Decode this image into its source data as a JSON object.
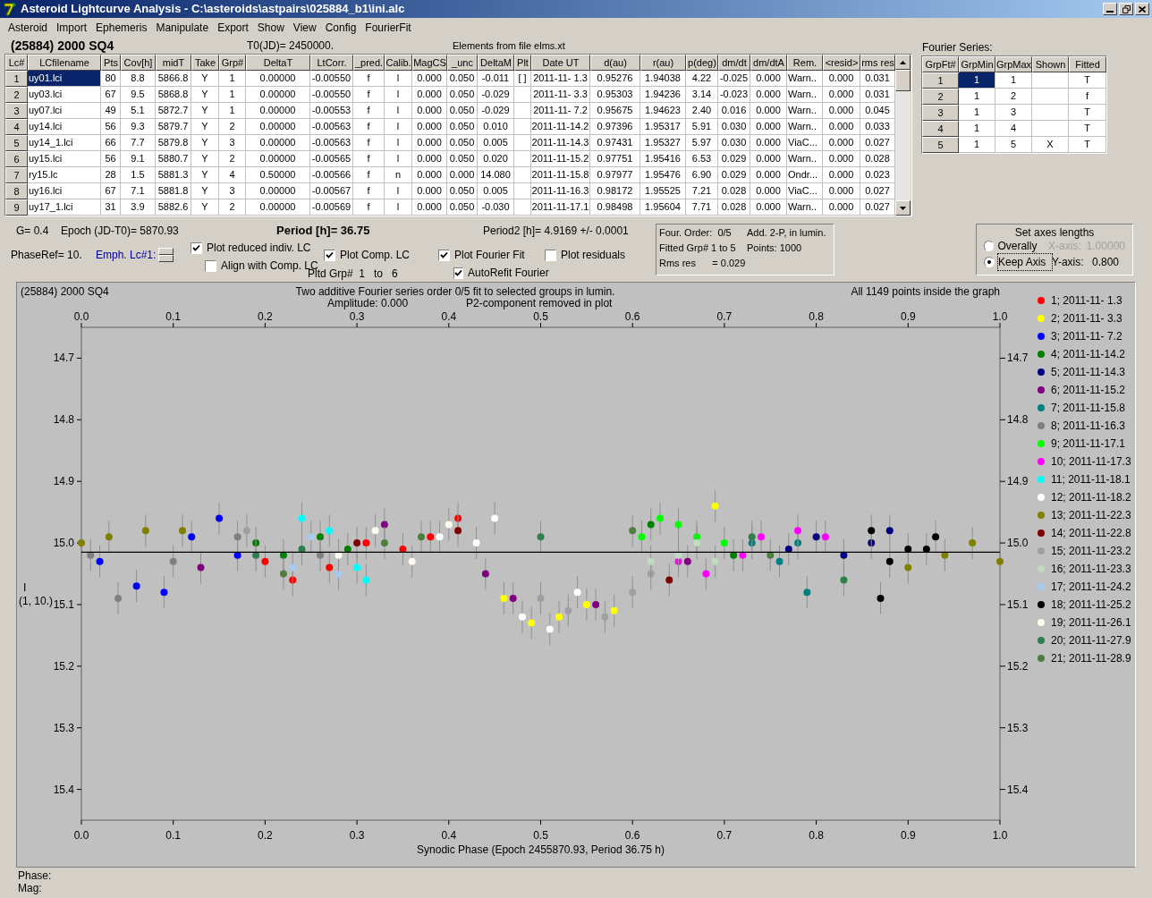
{
  "window": {
    "title": "Asteroid Lightcurve Analysis - C:\\asteroids\\astpairs\\025884_b1\\ini.alc"
  },
  "menu": [
    "Asteroid",
    "Import",
    "Ephemeris",
    "Manipulate",
    "Export",
    "Show",
    "View",
    "Config",
    "FourierFit"
  ],
  "header": {
    "asteroid": "(25884) 2000 SQ4",
    "t0": "T0(JD)= 2450000.",
    "elements": "Elements from file elms.xt"
  },
  "lc_table": {
    "columns": [
      "Lc#",
      "LCfilename",
      "Pts",
      "Cov[h]",
      "midT",
      "Take",
      "Grp#",
      "DeltaT",
      "LtCorr.",
      "_pred.",
      "Calib.",
      "MagCS",
      "_unc",
      "DeltaM",
      "Plt",
      "Date UT",
      "d(au)",
      "r(au)",
      "p(deg)",
      "dm/dt",
      "dm/dtA",
      "Rem.",
      "<resid>",
      "rms res"
    ],
    "rows": [
      {
        "selected": true,
        "cells": [
          "1",
          "uy01.lci",
          "80",
          "8.8",
          "5866.8",
          "Y",
          "1",
          "0.00000",
          "-0.00550",
          "f",
          "l",
          "0.000",
          "0.050",
          "-0.011",
          "[ ]",
          "2011-11- 1.3",
          "0.95276",
          "1.94038",
          "4.22",
          "-0.025",
          "0.000",
          "Warn..",
          "0.000",
          "0.031"
        ]
      },
      {
        "selected": false,
        "cells": [
          "2",
          "uy03.lci",
          "67",
          "9.5",
          "5868.8",
          "Y",
          "1",
          "0.00000",
          "-0.00550",
          "f",
          "l",
          "0.000",
          "0.050",
          "-0.029",
          "",
          "2011-11- 3.3",
          "0.95303",
          "1.94236",
          "3.14",
          "-0.023",
          "0.000",
          "Warn..",
          "0.000",
          "0.031"
        ]
      },
      {
        "selected": false,
        "cells": [
          "3",
          "uy07.lci",
          "49",
          "5.1",
          "5872.7",
          "Y",
          "1",
          "0.00000",
          "-0.00553",
          "f",
          "l",
          "0.000",
          "0.050",
          "-0.029",
          "",
          "2011-11- 7.2",
          "0.95675",
          "1.94623",
          "2.40",
          "0.016",
          "0.000",
          "Warn..",
          "0.000",
          "0.045"
        ]
      },
      {
        "selected": false,
        "cells": [
          "4",
          "uy14.lci",
          "56",
          "9.3",
          "5879.7",
          "Y",
          "2",
          "0.00000",
          "-0.00563",
          "f",
          "l",
          "0.000",
          "0.050",
          "0.010",
          "",
          "2011-11-14.2",
          "0.97396",
          "1.95317",
          "5.91",
          "0.030",
          "0.000",
          "Warn..",
          "0.000",
          "0.033"
        ]
      },
      {
        "selected": false,
        "cells": [
          "5",
          "uy14_1.lci",
          "66",
          "7.7",
          "5879.8",
          "Y",
          "3",
          "0.00000",
          "-0.00563",
          "f",
          "l",
          "0.000",
          "0.050",
          "0.005",
          "",
          "2011-11-14.3",
          "0.97431",
          "1.95327",
          "5.97",
          "0.030",
          "0.000",
          "ViaC...",
          "0.000",
          "0.027"
        ]
      },
      {
        "selected": false,
        "cells": [
          "6",
          "uy15.lci",
          "56",
          "9.1",
          "5880.7",
          "Y",
          "2",
          "0.00000",
          "-0.00565",
          "f",
          "l",
          "0.000",
          "0.050",
          "0.020",
          "",
          "2011-11-15.2",
          "0.97751",
          "1.95416",
          "6.53",
          "0.029",
          "0.000",
          "Warn..",
          "0.000",
          "0.028"
        ]
      },
      {
        "selected": false,
        "cells": [
          "7",
          "ry15.lc",
          "28",
          "1.5",
          "5881.3",
          "Y",
          "4",
          "0.50000",
          "-0.00566",
          "f",
          "n",
          "0.000",
          "0.000",
          "14.080",
          "",
          "2011-11-15.8",
          "0.97977",
          "1.95476",
          "6.90",
          "0.029",
          "0.000",
          "Ondr...",
          "0.000",
          "0.023"
        ]
      },
      {
        "selected": false,
        "cells": [
          "8",
          "uy16.lci",
          "67",
          "7.1",
          "5881.8",
          "Y",
          "3",
          "0.00000",
          "-0.00567",
          "f",
          "l",
          "0.000",
          "0.050",
          "0.005",
          "",
          "2011-11-16.3",
          "0.98172",
          "1.95525",
          "7.21",
          "0.028",
          "0.000",
          "ViaC...",
          "0.000",
          "0.027"
        ]
      },
      {
        "selected": false,
        "cells": [
          "9",
          "uy17_1.lci",
          "31",
          "3.9",
          "5882.6",
          "Y",
          "2",
          "0.00000",
          "-0.00569",
          "f",
          "l",
          "0.000",
          "0.050",
          "-0.030",
          "",
          "2011-11-17.1",
          "0.98498",
          "1.95604",
          "7.71",
          "0.028",
          "0.000",
          "Warn..",
          "0.000",
          "0.027"
        ]
      }
    ]
  },
  "fourier": {
    "title": "Fourier Series:",
    "columns": [
      "GrpFt#",
      "GrpMin",
      "GrpMax",
      "Shown",
      "Fitted"
    ],
    "rows": [
      {
        "selected": true,
        "cells": [
          "1",
          "1",
          "1",
          "",
          "T"
        ]
      },
      {
        "selected": false,
        "cells": [
          "2",
          "1",
          "2",
          "",
          "f"
        ]
      },
      {
        "selected": false,
        "cells": [
          "3",
          "1",
          "3",
          "",
          "T"
        ]
      },
      {
        "selected": false,
        "cells": [
          "4",
          "1",
          "4",
          "",
          "T"
        ]
      },
      {
        "selected": false,
        "cells": [
          "5",
          "1",
          "5",
          "X",
          "T"
        ]
      }
    ]
  },
  "info": {
    "g": "G= 0.4",
    "epoch": "Epoch (JD-T0)= 5870.93",
    "period": "Period [h]= 36.75",
    "period2": "Period2 [h]= 4.9169 +/- 0.0001",
    "phase_ref": "PhaseRef= 10.",
    "emph": "Emph. Lc#1:",
    "pltd_grp": "Pltd Grp#  1   to   6"
  },
  "options": [
    {
      "label": "Plot reduced indiv. LC",
      "checked": true
    },
    {
      "label": "Align with Comp. LC",
      "checked": false
    },
    {
      "label": "Plot Comp. LC",
      "checked": true
    },
    {
      "label": "Plot Fourier Fit",
      "checked": true
    },
    {
      "label": "AutoRefit Fourier",
      "checked": true
    },
    {
      "label": "Plot residuals",
      "checked": false
    }
  ],
  "fit_summary": [
    "Four. Order:  0/5",
    "Add. 2-P, in lumin.",
    "Fitted Grp# 1 to 5",
    "Points: 1000",
    "Rms res      = 0.029"
  ],
  "axes": {
    "title": "Set axes lengths",
    "modes": [
      {
        "label": "Overally",
        "selected": false
      },
      {
        "label": "Keep Axis",
        "selected": true
      }
    ],
    "x_label": "X-axis:",
    "x_value": "1.00000",
    "x_disabled": true,
    "y_label": "Y-axis:",
    "y_value": "0.800"
  },
  "plot": {
    "object": "(25884) 2000 SQ4",
    "caption": "Two additive Fourier series order 0/5 fit to selected groups in lumin.",
    "amplitude": "Amplitude: 0.000",
    "p2_note": "P2-component removed in plot",
    "inside_note": "All 1149 points inside the graph",
    "ylabel_note": "(1, 10.)",
    "chart_data": {
      "type": "scatter",
      "xlabel": "Synodic Phase (Epoch 2455870.93, Period 36.75 h)",
      "ylabel": "I",
      "xlim": [
        0,
        1
      ],
      "ylim": [
        15.45,
        14.65
      ],
      "xticks": [
        {
          "value": 0,
          "label": "0.0"
        },
        {
          "value": 0.1,
          "label": "0.1"
        },
        {
          "value": 0.2,
          "label": "0.2"
        },
        {
          "value": 0.3,
          "label": "0.3"
        },
        {
          "value": 0.4,
          "label": "0.4"
        },
        {
          "value": 0.5,
          "label": "0.5"
        },
        {
          "value": 0.6,
          "label": "0.6"
        },
        {
          "value": 0.7,
          "label": "0.7"
        },
        {
          "value": 0.8,
          "label": "0.8"
        },
        {
          "value": 0.9,
          "label": "0.9"
        },
        {
          "value": 1,
          "label": "1.0"
        }
      ],
      "yticks": [
        {
          "value": 14.7,
          "label": "14.7"
        },
        {
          "value": 14.8,
          "label": "14.8"
        },
        {
          "value": 14.9,
          "label": "14.9"
        },
        {
          "value": 15.0,
          "label": "15.0"
        },
        {
          "value": 15.1,
          "label": "15.1"
        },
        {
          "value": 15.2,
          "label": "15.2"
        },
        {
          "value": 15.3,
          "label": "15.3"
        },
        {
          "value": 15.4,
          "label": "15.4"
        }
      ],
      "ref_lines": [
        {
          "axis": "y",
          "value": 15.015
        }
      ],
      "legend": "right",
      "series": [
        {
          "name": "1; 2011-11- 1.3",
          "color": "#ff0000",
          "x": [
            0.2,
            0.23,
            0.27,
            0.31,
            0.35,
            0.38,
            0.41
          ],
          "values": [
            15.03,
            15.06,
            15.04,
            15.0,
            15.01,
            14.99,
            14.96
          ]
        },
        {
          "name": "2; 2011-11- 3.3",
          "color": "#ffff00",
          "x": [
            0.46,
            0.49,
            0.52,
            0.55,
            0.58,
            0.69
          ],
          "values": [
            15.09,
            15.13,
            15.12,
            15.1,
            15.11,
            14.94
          ]
        },
        {
          "name": "3; 2011-11- 7.2",
          "color": "#0000ff",
          "x": [
            0.02,
            0.06,
            0.09,
            0.12,
            0.15,
            0.17
          ],
          "values": [
            15.03,
            15.07,
            15.08,
            14.99,
            14.96,
            15.02
          ]
        },
        {
          "name": "4; 2011-11-14.2",
          "color": "#008000",
          "x": [
            0.19,
            0.22,
            0.26,
            0.29,
            0.62,
            0.71
          ],
          "values": [
            15.0,
            15.02,
            14.99,
            15.01,
            14.97,
            15.02
          ]
        },
        {
          "name": "5; 2011-11-14.3",
          "color": "#000080",
          "x": [
            0.77,
            0.8,
            0.83,
            0.86,
            0.88
          ],
          "values": [
            15.01,
            14.99,
            15.02,
            15.0,
            14.98
          ]
        },
        {
          "name": "6; 2011-11-15.2",
          "color": "#800080",
          "x": [
            0.13,
            0.33,
            0.44,
            0.47,
            0.56,
            0.66
          ],
          "values": [
            15.04,
            14.97,
            15.05,
            15.09,
            15.1,
            15.03
          ]
        },
        {
          "name": "7; 2011-11-15.8",
          "color": "#008080",
          "x": [
            0.73,
            0.76,
            0.78,
            0.79
          ],
          "values": [
            15.0,
            15.03,
            15.0,
            15.08
          ]
        },
        {
          "name": "8; 2011-11-16.3",
          "color": "#808080",
          "x": [
            0.01,
            0.04,
            0.1,
            0.17,
            0.26
          ],
          "values": [
            15.02,
            15.09,
            15.03,
            14.99,
            15.02
          ]
        },
        {
          "name": "9; 2011-11-17.1",
          "color": "#00ff00",
          "x": [
            0.61,
            0.63,
            0.65,
            0.67,
            0.7
          ],
          "values": [
            14.99,
            14.96,
            14.97,
            14.99,
            15.0
          ]
        },
        {
          "name": "10; 2011-11-17.3",
          "color": "#ff00ff",
          "x": [
            0.65,
            0.68,
            0.72,
            0.74,
            0.78,
            0.81
          ],
          "values": [
            15.03,
            15.05,
            15.02,
            14.99,
            14.98,
            14.99
          ]
        },
        {
          "name": "11; 2011-11-18.1",
          "color": "#00ffff",
          "x": [
            0.24,
            0.27,
            0.3,
            0.31
          ],
          "values": [
            14.96,
            14.98,
            15.04,
            15.06
          ]
        },
        {
          "name": "12; 2011-11-18.2",
          "color": "#ffffff",
          "x": [
            0.39,
            0.43,
            0.45,
            0.48,
            0.51,
            0.54
          ],
          "values": [
            14.99,
            15.0,
            14.96,
            15.12,
            15.14,
            15.08
          ]
        },
        {
          "name": "13; 2011-11-22.3",
          "color": "#808000",
          "x": [
            0.0,
            0.03,
            0.07,
            0.11,
            0.9,
            0.94,
            0.97,
            1.0
          ],
          "values": [
            15.0,
            14.99,
            14.98,
            14.98,
            15.04,
            15.02,
            15.0,
            15.03
          ]
        },
        {
          "name": "14; 2011-11-22.8",
          "color": "#800000",
          "x": [
            0.3,
            0.41,
            0.64
          ],
          "values": [
            15.0,
            14.98,
            15.06
          ]
        },
        {
          "name": "15; 2011-11-23.2",
          "color": "#a0a0a4",
          "x": [
            0.18,
            0.5,
            0.53,
            0.57,
            0.6,
            0.62
          ],
          "values": [
            14.98,
            15.09,
            15.11,
            15.12,
            15.08,
            15.05
          ]
        },
        {
          "name": "16; 2011-11-23.3",
          "color": "#c0dcc0",
          "x": [
            0.62,
            0.65,
            0.67,
            0.69
          ],
          "values": [
            15.03,
            15.02,
            15.0,
            15.03
          ]
        },
        {
          "name": "17; 2011-11-24.2",
          "color": "#a6caf0",
          "x": [
            0.23,
            0.25,
            0.28
          ],
          "values": [
            15.04,
            14.99,
            15.05
          ]
        },
        {
          "name": "18; 2011-11-25.2",
          "color": "#000000",
          "x": [
            0.86,
            0.87,
            0.88,
            0.9,
            0.92,
            0.93
          ],
          "values": [
            14.98,
            15.09,
            15.03,
            15.01,
            15.01,
            14.99
          ]
        },
        {
          "name": "19; 2011-11-26.1",
          "color": "#fffbf0",
          "x": [
            0.28,
            0.32,
            0.36,
            0.4
          ],
          "values": [
            15.02,
            14.98,
            15.03,
            14.97
          ]
        },
        {
          "name": "20; 2011-11-27.9",
          "color": "#2f7f4f",
          "x": [
            0.19,
            0.24,
            0.5,
            0.73,
            0.83
          ],
          "values": [
            15.02,
            15.01,
            14.99,
            14.99,
            15.06
          ]
        },
        {
          "name": "21; 2011-11-28.9",
          "color": "#4f7f3f",
          "x": [
            0.22,
            0.33,
            0.37,
            0.6,
            0.75
          ],
          "values": [
            15.05,
            15.0,
            14.99,
            14.98,
            15.02
          ]
        }
      ]
    }
  },
  "status": [
    "Phase:",
    "Mag:"
  ]
}
